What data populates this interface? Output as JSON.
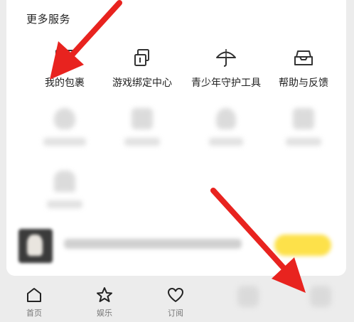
{
  "section": {
    "title": "更多服务"
  },
  "services": [
    {
      "label": "我的包裹",
      "icon": "package-box-icon"
    },
    {
      "label": "游戏绑定中心",
      "icon": "link-squares-icon"
    },
    {
      "label": "青少年守护工具",
      "icon": "umbrella-icon"
    },
    {
      "label": "帮助与反馈",
      "icon": "help-inbox-icon"
    }
  ],
  "tabbar": [
    {
      "label": "首页",
      "icon": "home-icon"
    },
    {
      "label": "娱乐",
      "icon": "star-icon"
    },
    {
      "label": "订阅",
      "icon": "heart-icon"
    }
  ],
  "colors": {
    "annotation_arrow": "#e8231f",
    "banner_button": "#fde14a"
  }
}
